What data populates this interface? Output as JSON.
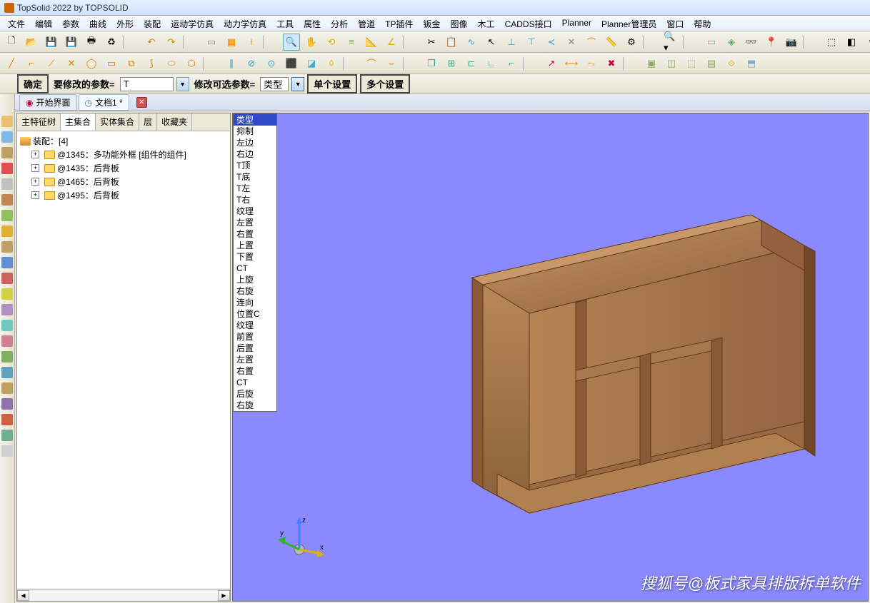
{
  "title": "TopSolid 2022 by TOPSOLID",
  "menus": [
    "文件",
    "编辑",
    "参数",
    "曲线",
    "外形",
    "装配",
    "运动学仿真",
    "动力学仿真",
    "工具",
    "属性",
    "分析",
    "管道",
    "TP插件",
    "钣金",
    "图像",
    "木工",
    "CADDS接口",
    "Planner",
    "Planner管理员",
    "窗口",
    "帮助"
  ],
  "param_bar": {
    "confirm": "确定",
    "label1": "要修改的参数=",
    "value1": "T",
    "label2": "修改可选参数=",
    "value2": "类型",
    "btn1": "单个设置",
    "btn2": "多个设置"
  },
  "doc_tabs": {
    "home": "开始界面",
    "doc": "文档1 *"
  },
  "tree_tabs": [
    "主特征树",
    "主集合",
    "实体集合",
    "层",
    "收藏夹"
  ],
  "tree": {
    "root": "装配：[4]",
    "items": [
      "@1345：多功能外框 [组件的组件]",
      "@1435：后背板",
      "@1465：后背板",
      "@1495：后背板"
    ]
  },
  "dropdown_items": [
    "类型",
    "抑制",
    "左边",
    "右边",
    "T顶",
    "T底",
    "T左",
    "T右",
    "纹理",
    "左置",
    "右置",
    "上置",
    "下置",
    "CT",
    "上旋",
    "右旋",
    "连向",
    "位置C",
    "纹理",
    "前置",
    "后置",
    "左置",
    "右置",
    "CT",
    "后旋",
    "右旋"
  ],
  "axes": {
    "x": "x",
    "y": "y",
    "z": "z"
  },
  "watermark": "搜狐号@板式家具排版拆单软件"
}
